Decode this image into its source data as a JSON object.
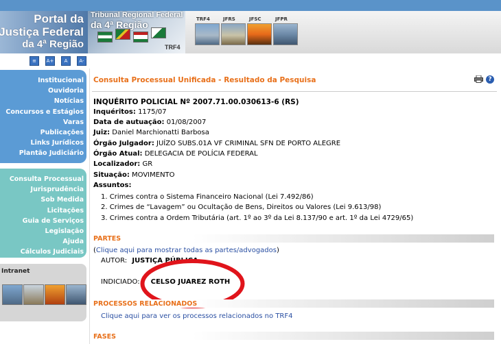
{
  "header": {
    "portal_lines": [
      "Portal da",
      "Justiça Federal",
      "da 4ª Região"
    ],
    "court_lines": [
      "Tribunal Regional Federal",
      "da 4ª Região"
    ],
    "court_tag": "TRF4",
    "sites": [
      "TRF4",
      "JFRS",
      "JFSC",
      "JFPR"
    ],
    "font_buttons": [
      "≡",
      "A+",
      "A",
      "A-"
    ]
  },
  "nav_primary": [
    "Institucional",
    "Ouvidoria",
    "Notícias",
    "Concursos e Estágios",
    "Varas",
    "Publicações",
    "Links Jurídicos",
    "Plantão Judiciário"
  ],
  "nav_secondary": [
    "Consulta Processual",
    "Jurisprudência",
    "Sob Medida",
    "Licitações",
    "Guia de Serviços",
    "Legislação",
    "Ajuda",
    "Cálculos Judiciais"
  ],
  "intranet": {
    "label": "Intranet"
  },
  "page": {
    "title": "Consulta Processual Unificada - Resultado da Pesquisa",
    "help": "?"
  },
  "process": {
    "heading": "INQUÉRITO POLICIAL Nº 2007.71.00.030613-6 (RS)",
    "fields": [
      {
        "label": "Inquéritos:",
        "value": "1175/07"
      },
      {
        "label": "Data de autuação:",
        "value": "01/08/2007"
      },
      {
        "label": "Juiz:",
        "value": "Daniel Marchionatti Barbosa"
      },
      {
        "label": "Órgão Julgador:",
        "value": "JUÍZO SUBS.01A VF CRIMINAL SFN DE PORTO ALEGRE"
      },
      {
        "label": "Órgão Atual:",
        "value": "DELEGACIA DE POLÍCIA FEDERAL"
      },
      {
        "label": "Localizador:",
        "value": "GR"
      },
      {
        "label": "Situação:",
        "value": "MOVIMENTO"
      }
    ],
    "subjects_label": "Assuntos:",
    "subjects": [
      "1. Crimes contra o Sistema Financeiro Nacional (Lei 7.492/86)",
      "2. Crimes de “Lavagem” ou Ocultação de Bens, Direitos ou Valores (Lei 9.613/98)",
      "3. Crimes contra a Ordem Tributária (art. 1º ao 3º da Lei 8.137/90 e art. 1º da Lei 4729/65)"
    ]
  },
  "parties": {
    "section": "PARTES",
    "show_all_prefix": "(",
    "show_all_link": "Clique aqui para mostrar todas as partes/advogados",
    "show_all_suffix": ")",
    "author_label": "AUTOR:",
    "author_value": "JUSTIÇA PÚBLICA",
    "indicted_label": "INDICIADO:",
    "indicted_value": "CELSO JUAREZ ROTH"
  },
  "related": {
    "section": "PROCESSOS RELACIONADOS",
    "link": "Clique aqui para ver os processos relacionados no TRF4"
  },
  "phases": {
    "section": "FASES"
  },
  "colors": {
    "accent": "#e8701a",
    "nav_blue": "#5b9bd5",
    "nav_teal": "#79c7c4",
    "link": "#2a4fa2",
    "highlight": "#e0141b"
  }
}
